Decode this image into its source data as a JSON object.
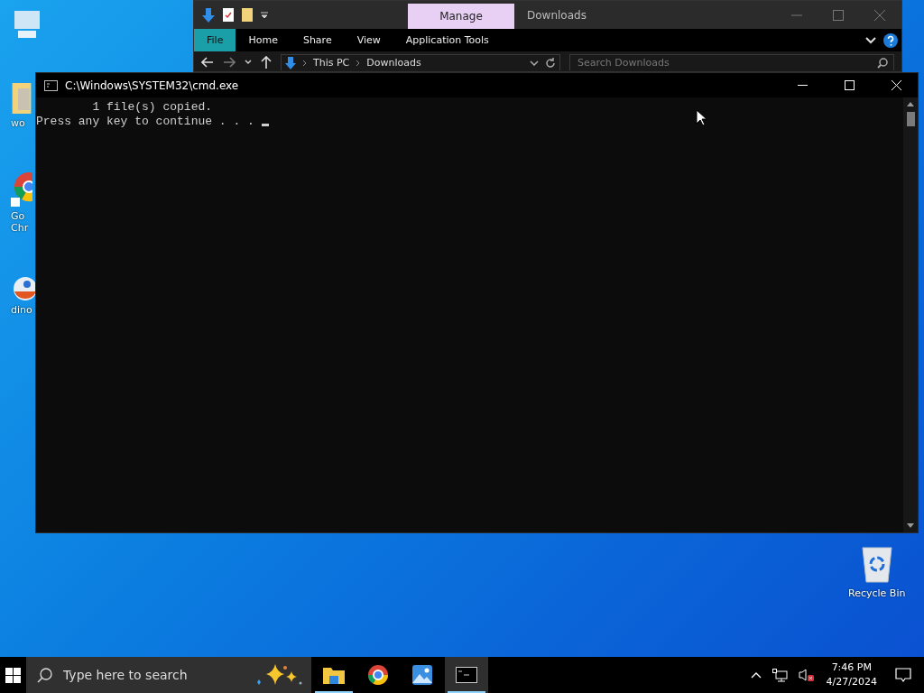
{
  "desktop_icons": [
    {
      "kind": "computer"
    },
    {
      "kind": "folder",
      "label": "wo"
    },
    {
      "kind": "browser",
      "label": "Go\nChr"
    },
    {
      "kind": "game",
      "label": "dino"
    }
  ],
  "recycle_bin": {
    "label": "Recycle Bin"
  },
  "explorer": {
    "contextual_tab": "Manage",
    "title": "Downloads",
    "ribbon_tabs": [
      {
        "label": "File",
        "selected": true
      },
      {
        "label": "Home",
        "selected": false
      },
      {
        "label": "Share",
        "selected": false
      },
      {
        "label": "View",
        "selected": false
      },
      {
        "label": "Application Tools",
        "selected": false
      }
    ],
    "breadcrumb": [
      "This PC",
      "Downloads"
    ],
    "search": {
      "placeholder": "Search Downloads"
    }
  },
  "cmd": {
    "title": "C:\\Windows\\SYSTEM32\\cmd.exe",
    "lines": [
      "        1 file(s) copied.",
      "Press any key to continue . . . "
    ]
  },
  "taskbar": {
    "search": {
      "placeholder": "Type here to search"
    },
    "apps": [
      {
        "kind": "explorer",
        "running": true,
        "active": false
      },
      {
        "kind": "chrome",
        "running": false,
        "active": false
      },
      {
        "kind": "photos",
        "running": false,
        "active": false
      },
      {
        "kind": "terminal",
        "running": true,
        "active": true
      }
    ],
    "time": "7:46 PM",
    "date": "4/27/2024"
  }
}
